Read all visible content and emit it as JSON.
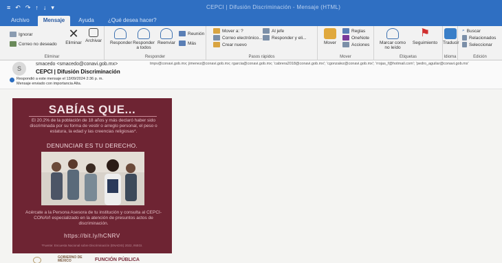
{
  "window": {
    "title": "CEPCI | Difusión Discriminación - Mensaje (HTML)",
    "quick_access": [
      "≡",
      "↶",
      "↷",
      "↑",
      "↓",
      "▾"
    ]
  },
  "tabs": [
    "Archivo",
    "Mensaje",
    "Ayuda",
    "¿Qué desea hacer?"
  ],
  "active_tab": "Mensaje",
  "ribbon": {
    "eliminar": {
      "label": "Eliminar",
      "ignorar": "Ignorar",
      "correo_no_deseado": "Correo no deseado",
      "eliminar_btn": "Eliminar",
      "archivar_btn": "Archivar"
    },
    "responder": {
      "label": "Responder",
      "responder": "Responder",
      "responder_todos": "Responder a todos",
      "reenviar": "Reenviar",
      "reunion": "Reunión",
      "mas": "Más"
    },
    "pasos": {
      "label": "Pasos rápidos",
      "items": [
        "Mover a: ?",
        "Correo electrónico...",
        "Crear nuevo",
        "Al jefe",
        "Responder y eli..."
      ]
    },
    "mover": {
      "label": "Mover",
      "mover": "Mover",
      "reglas": "Reglas",
      "onenote": "OneNote",
      "acciones": "Acciones"
    },
    "etiquetas": {
      "label": "Etiquetas",
      "marcar_no_leido": "Marcar como no leído",
      "seguimiento": "Seguimiento"
    },
    "edicion": {
      "label": "Edición",
      "traducir": "Traducir",
      "buscar": "Buscar",
      "relacionados": "Relacionados",
      "seleccionar": "Seleccionar"
    },
    "idioma": {
      "label": "Idioma"
    }
  },
  "message": {
    "avatar_initial": "S",
    "from": "smacedo <smacedo@conavi.gob.mx>",
    "subject": "CEPCI | Difusión Discriminación",
    "to_line": "tmpv@conavi.gob.mx; jimenez@conavi.gob.mx; rgarcia@conavi.gob.mx; 'cabrera2018@conavi.gob.mx'; 'cgonzalez@conavi.gob.mx'; 'rrojas_f@hotmail.com'; 'pedro_aguilar@conavi.gob.mx'",
    "info_line1": "Respondió a este mensaje el 13/09/2024 2:36 p. m.",
    "info_line2": "Mensaje enviado con importancia Alta."
  },
  "poster": {
    "title": "SABÍAS QUE...",
    "paragraph1": "El 20.2% de la población de 18 años y más declaró haber sido discriminada por su forma de vestir o arreglo personal, el peso o estatura, la edad y las creencias religiosas*.",
    "subtitle": "DENUNCIAR ES TU DERECHO.",
    "paragraph2": "Acércate a la Persona Asesora de tu institución y consulta al CEPCI-CONAVI especializado en la atención de presuntos actos de discriminación.",
    "url": "https://bit.ly/hCNRV",
    "source": "*Fuente: Encuesta Nacional sobre Discriminación (ENADIS) 2022, INEGI."
  },
  "footer": {
    "logo_gobierno_line1": "GOBIERNO DE",
    "logo_gobierno_line2": "MÉXICO",
    "logo_funcion": "FUNCIÓN PÚBLICA"
  },
  "colors": {
    "titlebar": "#2f6fc2",
    "poster_bg": "#6e2433",
    "poster_text": "#e8c9cf"
  },
  "icons": {
    "ignorar": "ignore-icon",
    "eliminar": "delete-x-icon",
    "archivar": "archive-icon",
    "responder": "reply-icon",
    "responder_todos": "reply-all-icon",
    "reenviar": "forward-icon",
    "mover": "folder-move-icon",
    "seguimiento": "flag-icon",
    "traducir": "translate-icon"
  }
}
